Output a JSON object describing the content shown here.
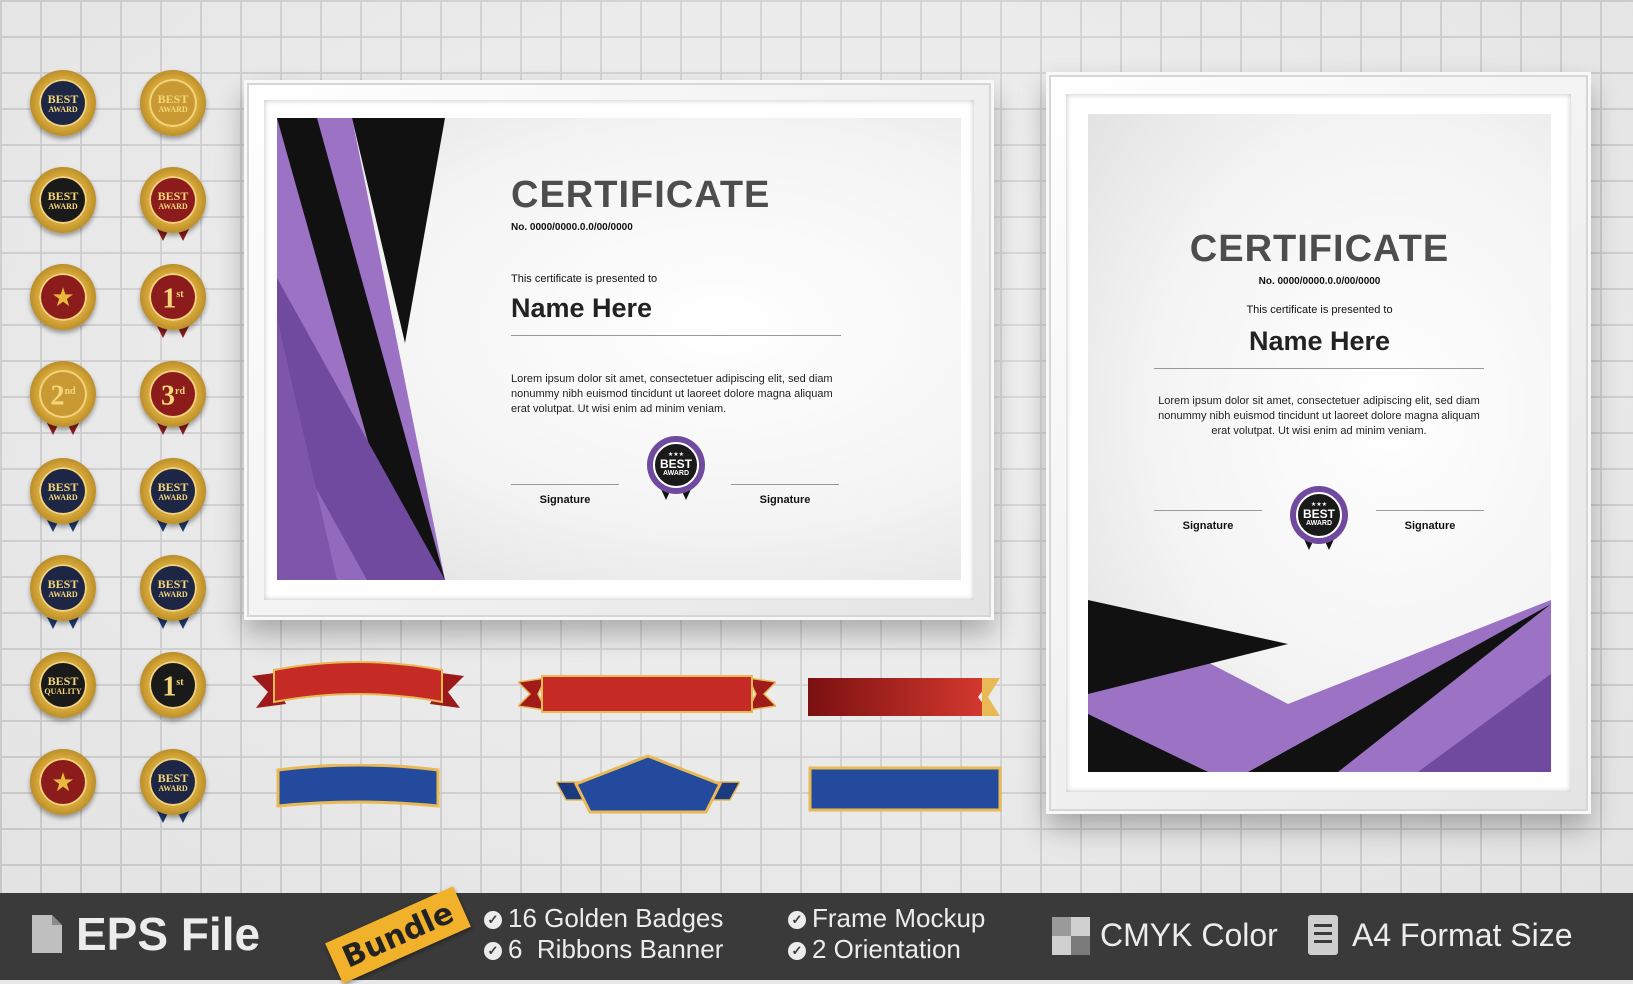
{
  "colors": {
    "purple": "#9b72c4",
    "dark_purple": "#6f4a9e",
    "black": "#111111",
    "gold": "#d4a536",
    "footer_bg": "#3a3a3a",
    "bundle_tag": "#f1b12b"
  },
  "badges": [
    {
      "top": "BEST",
      "bottom": "AWARD",
      "style": "navy"
    },
    {
      "top": "BEST",
      "bottom": "AWARD",
      "style": "gold-ribbon"
    },
    {
      "top": "BEST",
      "bottom": "AWARD",
      "style": "black"
    },
    {
      "top": "BEST",
      "bottom": "AWARD",
      "style": "red"
    },
    {
      "big": "★",
      "style": "red-star"
    },
    {
      "big": "1",
      "sup": "st",
      "style": "red"
    },
    {
      "big": "2",
      "sup": "nd",
      "style": "gold"
    },
    {
      "big": "3",
      "sup": "rd",
      "style": "red"
    },
    {
      "top": "BEST",
      "bottom": "AWARD",
      "style": "navy"
    },
    {
      "top": "BEST",
      "bottom": "AWARD",
      "style": "navy"
    },
    {
      "top": "BEST",
      "bottom": "AWARD",
      "style": "navy"
    },
    {
      "top": "BEST",
      "bottom": "AWARD",
      "style": "navy"
    },
    {
      "top": "BEST",
      "bottom": "QUALITY",
      "style": "black"
    },
    {
      "big": "1",
      "sup": "st",
      "style": "black"
    },
    {
      "big": "★",
      "style": "red-star"
    },
    {
      "top": "BEST",
      "bottom": "AWARD",
      "style": "navy"
    }
  ],
  "cert_landscape": {
    "title": "CERTIFICATE",
    "number": "No. 0000/0000.0.0/00/0000",
    "presented": "This certificate is presented to",
    "name": "Name Here",
    "lorem": "Lorem ipsum dolor sit amet, consectetuer adipiscing elit, sed diam nonummy nibh euismod tincidunt ut laoreet dolore magna aliquam erat volutpat. Ut wisi enim ad minim veniam.",
    "sig_left": "Signature",
    "sig_right": "Signature",
    "seal_top": "BEST",
    "seal_bottom": "AWARD"
  },
  "cert_portrait": {
    "title": "CERTIFICATE",
    "number": "No. 0000/0000.0.0/00/0000",
    "presented": "This certificate is presented to",
    "name": "Name Here",
    "lorem": "Lorem ipsum dolor sit amet, consectetuer adipiscing elit, sed diam nonummy nibh euismod tincidunt ut laoreet dolore magna aliquam erat volutpat. Ut wisi enim ad minim veniam.",
    "sig_left": "Signature",
    "sig_right": "Signature",
    "seal_top": "BEST",
    "seal_bottom": "AWARD"
  },
  "footer": {
    "file_label": "EPS File",
    "bundle": "Bundle",
    "features": [
      "16 Golden Badges",
      "6  Ribbons Banner",
      "Frame Mockup",
      "2 Orientation"
    ],
    "color_label": "CMYK Color",
    "size_label": "A4 Format Size",
    "icons": [
      "file-icon",
      "check-icon",
      "color-swatch-icon",
      "document-icon"
    ]
  }
}
